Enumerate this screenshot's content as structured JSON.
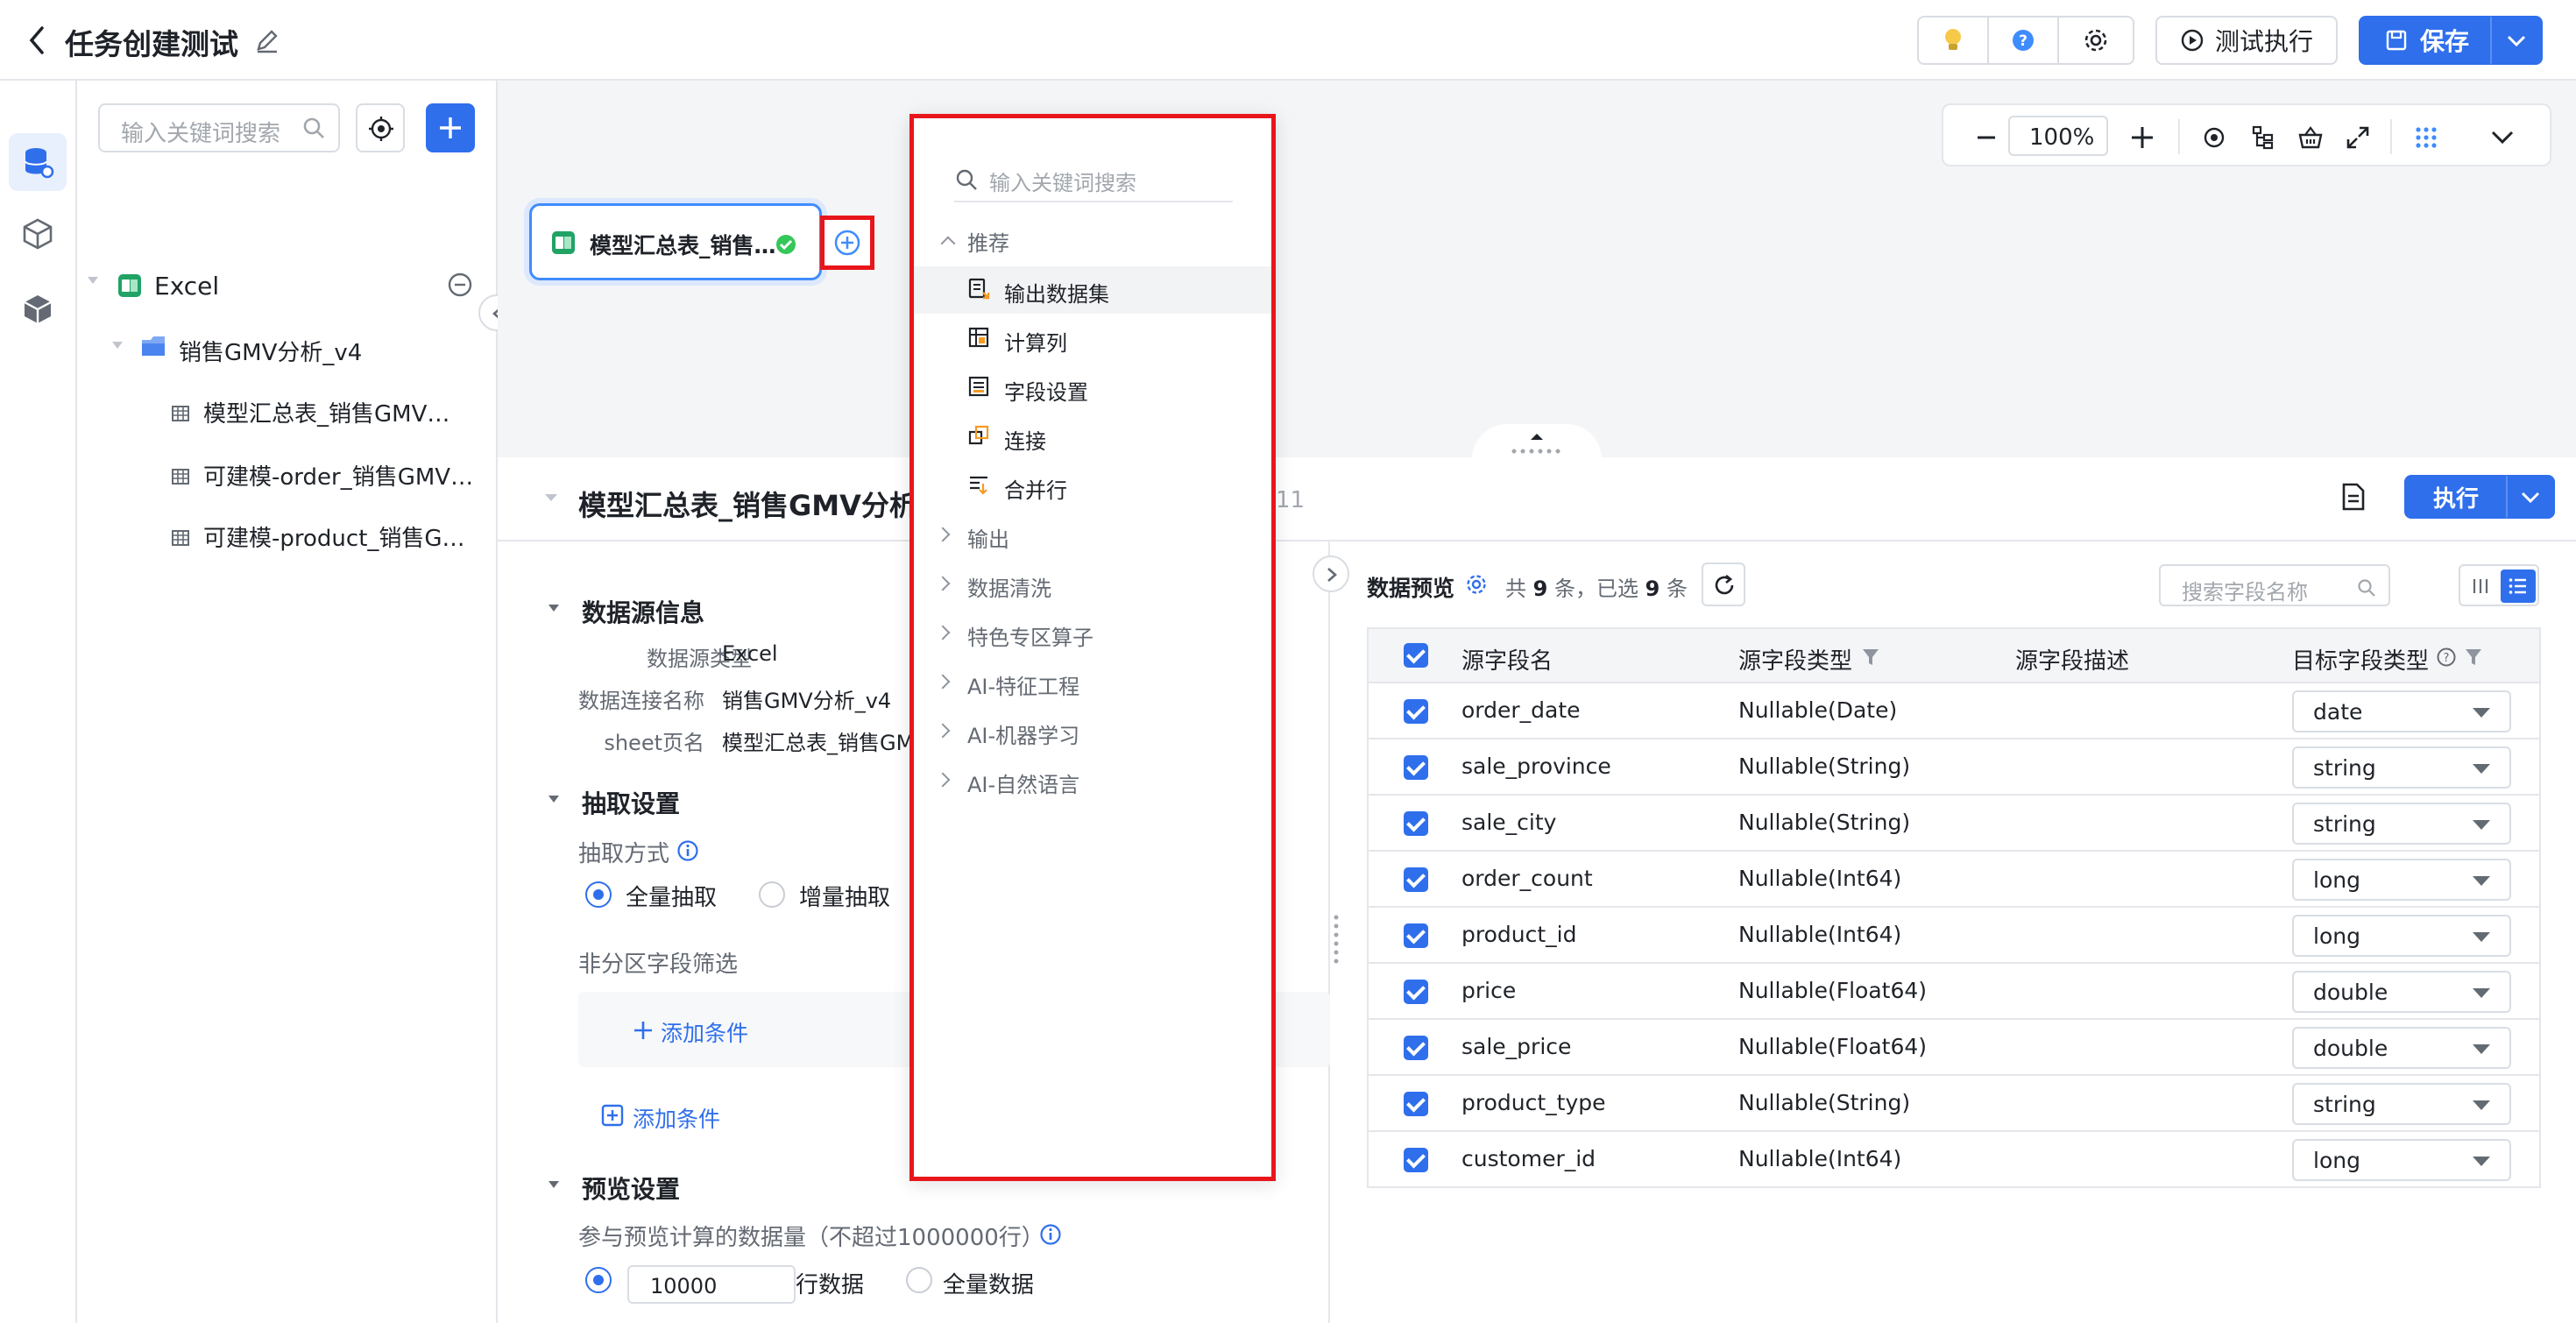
{
  "header": {
    "title": "任务创建测试",
    "test_run_label": "测试执行",
    "save_label": "保存"
  },
  "tree": {
    "search_placeholder": "输入关键词搜索",
    "root_label": "Excel",
    "folder_label": "销售GMV分析_v4",
    "items": [
      {
        "label": "模型汇总表_销售GMV…"
      },
      {
        "label": "可建模-order_销售GMV…"
      },
      {
        "label": "可建模-product_销售G…"
      }
    ]
  },
  "canvas": {
    "node_label": "模型汇总表_销售…",
    "zoom": "100%"
  },
  "menu": {
    "search_placeholder": "输入关键词搜索",
    "groups": [
      {
        "label": "推荐",
        "expanded": true,
        "items": [
          {
            "label": "输出数据集"
          },
          {
            "label": "计算列"
          },
          {
            "label": "字段设置"
          },
          {
            "label": "连接"
          },
          {
            "label": "合并行"
          }
        ]
      },
      {
        "label": "输出"
      },
      {
        "label": "数据清洗"
      },
      {
        "label": "特色专区算子"
      },
      {
        "label": "AI-特征工程"
      },
      {
        "label": "AI-机器学习"
      },
      {
        "label": "AI-自然语言"
      }
    ]
  },
  "panel": {
    "title": "模型汇总表_销售GMV分析_",
    "title_suffix": "11",
    "run_label": "执行",
    "datasource": {
      "section_title": "数据源信息",
      "rows": [
        {
          "label": "数据源类型",
          "value": "Excel"
        },
        {
          "label": "数据连接名称",
          "value": "销售GMV分析_v4"
        },
        {
          "label": "sheet页名",
          "value": "模型汇总表_销售GMV"
        }
      ]
    },
    "extract": {
      "section_title": "抽取设置",
      "method_label": "抽取方式",
      "options": [
        "全量抽取",
        "增量抽取"
      ],
      "selected": "全量抽取",
      "filter_label": "非分区字段筛选",
      "add_condition_inner": "添加条件",
      "add_condition_outer": "添加条件"
    },
    "preview_settings": {
      "section_title": "预览设置",
      "count_label": "参与预览计算的数据量（不超过1000000行）",
      "count_value": "10000",
      "rows_label": "行数据",
      "all_label": "全量数据"
    }
  },
  "preview": {
    "title": "数据预览",
    "summary_prefix": "共",
    "total": "9",
    "summary_mid": "条，已选",
    "selected": "9",
    "summary_suffix": "条",
    "search_placeholder": "搜索字段名称",
    "columns": [
      "源字段名",
      "源字段类型",
      "源字段描述",
      "目标字段类型"
    ],
    "rows": [
      {
        "name": "order_date",
        "type": "Nullable(Date)",
        "target": "date"
      },
      {
        "name": "sale_province",
        "type": "Nullable(String)",
        "target": "string"
      },
      {
        "name": "sale_city",
        "type": "Nullable(String)",
        "target": "string"
      },
      {
        "name": "order_count",
        "type": "Nullable(Int64)",
        "target": "long"
      },
      {
        "name": "product_id",
        "type": "Nullable(Int64)",
        "target": "long"
      },
      {
        "name": "price",
        "type": "Nullable(Float64)",
        "target": "double"
      },
      {
        "name": "sale_price",
        "type": "Nullable(Float64)",
        "target": "double"
      },
      {
        "name": "product_type",
        "type": "Nullable(String)",
        "target": "string"
      },
      {
        "name": "customer_id",
        "type": "Nullable(Int64)",
        "target": "long"
      }
    ]
  },
  "colors": {
    "accent": "#2f6fec",
    "highlight": "#e8161b",
    "excel": "#21a366"
  }
}
